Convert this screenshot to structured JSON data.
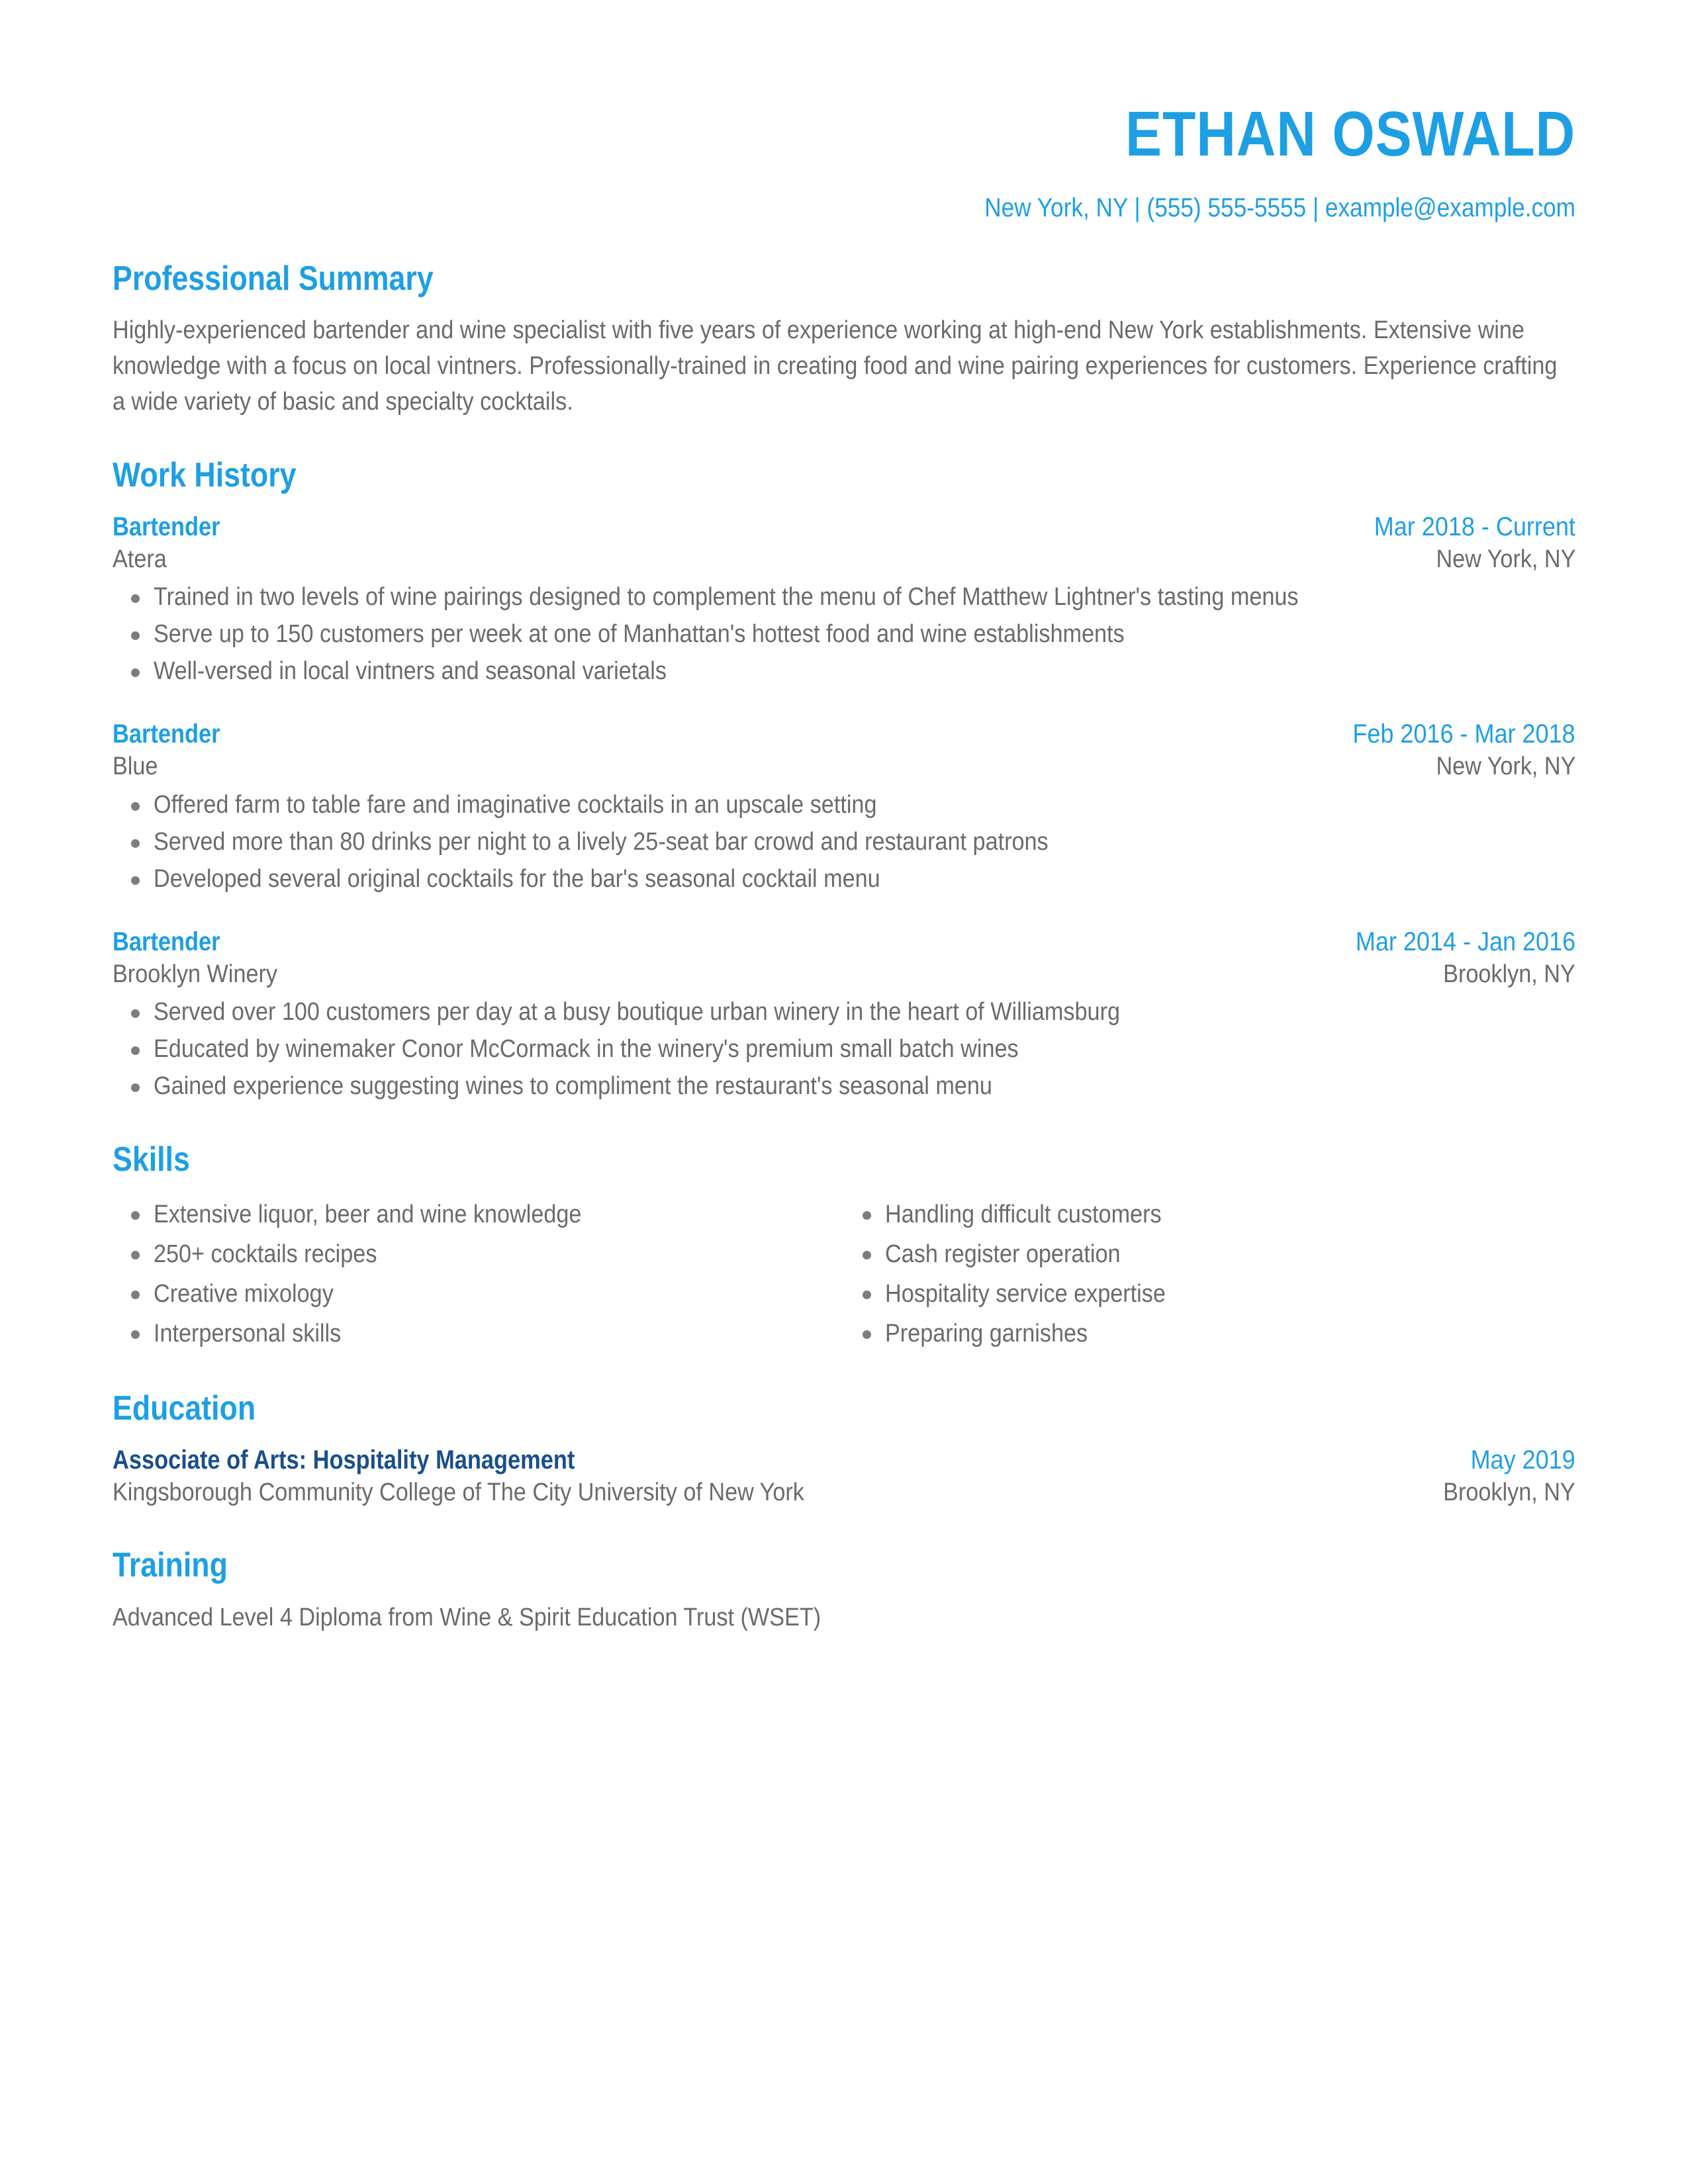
{
  "theme": {
    "accent_blue": "#1e9fe3",
    "degree_navy": "#1a4f8a",
    "body_gray": "#6b6b6b",
    "bullet_gray": "#7d7d7d",
    "background": "#ffffff"
  },
  "header": {
    "full_name": "ETHAN OSWALD",
    "contact_line": "New York, NY | (555) 555-5555 | example@example.com"
  },
  "sections": {
    "professional_summary": {
      "title": "Professional Summary",
      "text": "Highly-experienced bartender and wine specialist with five years of experience working at high-end New York establishments. Extensive wine knowledge with a focus on local vintners. Professionally-trained in creating food and wine pairing experiences for customers. Experience crafting a wide variety of basic and specialty cocktails."
    },
    "work_history": {
      "title": "Work History",
      "jobs": [
        {
          "title": "Bartender",
          "dates": "Mar 2018 - Current",
          "company": "Atera",
          "location": "New York, NY",
          "bullets": [
            "Trained in two levels of wine pairings designed to complement the menu of Chef Matthew Lightner's tasting menus",
            "Serve up to 150 customers per week at one of Manhattan's hottest food and wine establishments",
            "Well-versed in local vintners and seasonal varietals"
          ]
        },
        {
          "title": "Bartender",
          "dates": "Feb 2016 - Mar 2018",
          "company": "Blue",
          "location": "New York, NY",
          "bullets": [
            "Offered farm to table fare and imaginative cocktails in an upscale setting",
            "Served more than 80 drinks per night to a lively 25-seat bar crowd and restaurant patrons",
            "Developed several original cocktails for the bar's seasonal cocktail menu"
          ]
        },
        {
          "title": "Bartender",
          "dates": "Mar 2014 - Jan 2016",
          "company": "Brooklyn Winery",
          "location": "Brooklyn, NY",
          "bullets": [
            "Served over 100 customers per day at a busy boutique urban winery in the heart of Williamsburg",
            "Educated by winemaker Conor McCormack in the winery's premium small batch wines",
            "Gained experience suggesting wines to compliment the restaurant's seasonal menu"
          ]
        }
      ]
    },
    "skills": {
      "title": "Skills",
      "column_left": [
        "Extensive liquor, beer and wine knowledge",
        "250+ cocktails recipes",
        "Creative mixology",
        "Interpersonal skills"
      ],
      "column_right": [
        "Handling difficult customers",
        "Cash register operation",
        "Hospitality service expertise",
        "Preparing garnishes"
      ]
    },
    "education": {
      "title": "Education",
      "entries": [
        {
          "degree_type": "Associate of Arts",
          "separator": ":",
          "degree_field": "Hospitality Management",
          "date": "May 2019",
          "school": "Kingsborough Community College of The City University of New York",
          "location": "Brooklyn, NY"
        }
      ]
    },
    "training": {
      "title": "Training",
      "text": "Advanced Level 4 Diploma from Wine & Spirit Education Trust (WSET)"
    }
  }
}
